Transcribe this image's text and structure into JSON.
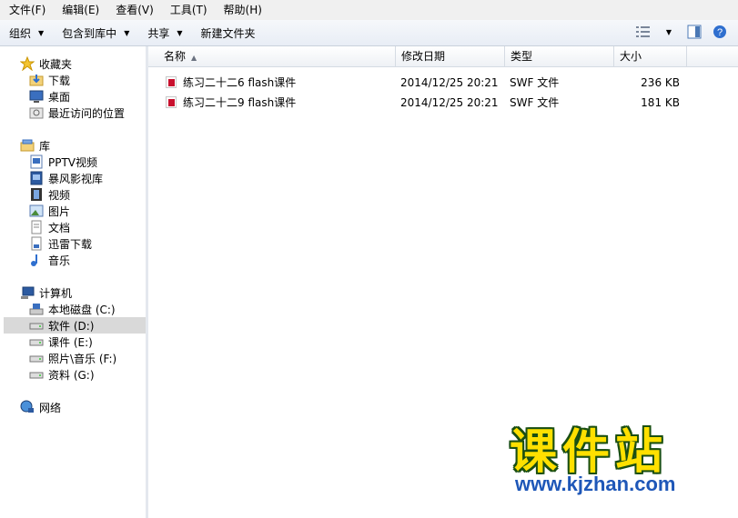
{
  "menubar": [
    "文件(F)",
    "编辑(E)",
    "查看(V)",
    "工具(T)",
    "帮助(H)"
  ],
  "toolbar": {
    "organize": "组织",
    "include_library": "包含到库中",
    "share": "共享",
    "new_folder": "新建文件夹"
  },
  "nav": {
    "favorites": {
      "label": "收藏夹",
      "items": [
        "下载",
        "桌面",
        "最近访问的位置"
      ]
    },
    "libraries": {
      "label": "库",
      "items": [
        "PPTV视频",
        "暴风影视库",
        "视频",
        "图片",
        "文档",
        "迅雷下载",
        "音乐"
      ]
    },
    "computer": {
      "label": "计算机",
      "items": [
        "本地磁盘 (C:)",
        "软件 (D:)",
        "课件 (E:)",
        "照片\\音乐 (F:)",
        "资料 (G:)"
      ],
      "selected_index": 1
    },
    "network": "网络"
  },
  "columns": [
    "名称",
    "修改日期",
    "类型",
    "大小"
  ],
  "files": [
    {
      "name": "练习二十二6 flash课件",
      "date": "2014/12/25 20:21",
      "type": "SWF 文件",
      "size": "236 KB"
    },
    {
      "name": "练习二十二9 flash课件",
      "date": "2014/12/25 20:21",
      "type": "SWF 文件",
      "size": "181 KB"
    }
  ],
  "watermark": {
    "logo_text": "课件站",
    "url": "www.kjzhan.com"
  },
  "colors": {
    "accent_blue": "#1e57b8",
    "watermark_yellow": "#ffe000",
    "selected_bg": "#d9d9d9"
  }
}
